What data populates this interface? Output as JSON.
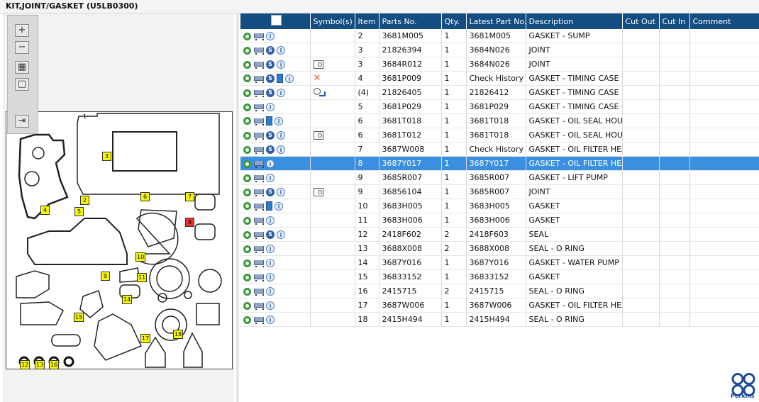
{
  "window_title": "KIT,JOINT/GASKET (U5LB0300)",
  "diagram": {
    "top_label": "1",
    "toolbar": [
      "zoom-in",
      "zoom-out",
      "fit",
      "actual-size",
      "export"
    ]
  },
  "columns": [
    "",
    "Symbol(s)",
    "Item",
    "Parts No.",
    "Qty.",
    "Latest Part No.",
    "Description",
    "Cut Out",
    "Cut In",
    "Comment"
  ],
  "rows": [
    {
      "icons": [
        "gear",
        "cart",
        "info"
      ],
      "symbol": "",
      "item": "2",
      "parts_no": "3681M005",
      "qty": "1",
      "latest": "3681M005",
      "desc": "GASKET - SUMP",
      "cut_out": "",
      "cut_in": "",
      "comment": ""
    },
    {
      "icons": [
        "gear",
        "cart",
        "s",
        "info"
      ],
      "symbol": "",
      "item": "3",
      "parts_no": "21826394",
      "qty": "1",
      "latest": "3684N026",
      "desc": "JOINT",
      "cut_out": "",
      "cut_in": "",
      "comment": ""
    },
    {
      "icons": [
        "gear",
        "cart",
        "s",
        "info"
      ],
      "symbol": "book-view",
      "item": "3",
      "parts_no": "3684R012",
      "qty": "1",
      "latest": "3684N026",
      "desc": "JOINT",
      "cut_out": "",
      "cut_in": "",
      "comment": ""
    },
    {
      "icons": [
        "gear",
        "cart",
        "s",
        "book",
        "info"
      ],
      "symbol": "x",
      "item": "4",
      "parts_no": "3681P009",
      "qty": "1",
      "latest": "Check History",
      "desc": "GASKET - TIMING CASE",
      "cut_out": "",
      "cut_in": "",
      "comment": ""
    },
    {
      "icons": [
        "gear",
        "cart",
        "s",
        "info"
      ],
      "symbol": "history",
      "item": "(4)",
      "parts_no": "21826405",
      "qty": "1",
      "latest": "21826412",
      "desc": "GASKET - TIMING CASE",
      "cut_out": "",
      "cut_in": "",
      "comment": ""
    },
    {
      "icons": [
        "gear",
        "cart",
        "info"
      ],
      "symbol": "",
      "item": "5",
      "parts_no": "3681P029",
      "qty": "1",
      "latest": "3681P029",
      "desc": "GASKET - TIMING CASE CO",
      "cut_out": "",
      "cut_in": "",
      "comment": ""
    },
    {
      "icons": [
        "gear",
        "cart",
        "book",
        "info"
      ],
      "symbol": "",
      "item": "6",
      "parts_no": "3681T018",
      "qty": "1",
      "latest": "3681T018",
      "desc": "GASKET - OIL SEAL HOUSIN",
      "cut_out": "",
      "cut_in": "",
      "comment": ""
    },
    {
      "icons": [
        "gear",
        "cart",
        "s",
        "info"
      ],
      "symbol": "book-view",
      "item": "6",
      "parts_no": "3681T012",
      "qty": "1",
      "latest": "3681T018",
      "desc": "GASKET - OIL SEAL HOUSIN",
      "cut_out": "",
      "cut_in": "",
      "comment": ""
    },
    {
      "icons": [
        "gear",
        "cart",
        "s",
        "info"
      ],
      "symbol": "",
      "item": "7",
      "parts_no": "3687W008",
      "qty": "1",
      "latest": "Check History",
      "desc": "GASKET - OIL FILTER HEAD",
      "cut_out": "",
      "cut_in": "",
      "comment": ""
    },
    {
      "icons": [
        "gear",
        "cart",
        "info"
      ],
      "symbol": "",
      "item": "8",
      "parts_no": "3687Y017",
      "qty": "1",
      "latest": "3687Y017",
      "desc": "GASKET - OIL FILTER HEAD",
      "cut_out": "",
      "cut_in": "",
      "comment": "",
      "selected": true
    },
    {
      "icons": [
        "gear",
        "cart",
        "info"
      ],
      "symbol": "",
      "item": "9",
      "parts_no": "3685R007",
      "qty": "1",
      "latest": "3685R007",
      "desc": "GASKET - LIFT PUMP",
      "cut_out": "",
      "cut_in": "",
      "comment": ""
    },
    {
      "icons": [
        "gear",
        "cart",
        "s",
        "info"
      ],
      "symbol": "book-view",
      "item": "9",
      "parts_no": "36856104",
      "qty": "1",
      "latest": "3685R007",
      "desc": "JOINT",
      "cut_out": "",
      "cut_in": "",
      "comment": ""
    },
    {
      "icons": [
        "gear",
        "cart",
        "book",
        "info"
      ],
      "symbol": "",
      "item": "10",
      "parts_no": "3683H005",
      "qty": "1",
      "latest": "3683H005",
      "desc": "GASKET",
      "cut_out": "",
      "cut_in": "",
      "comment": ""
    },
    {
      "icons": [
        "gear",
        "cart",
        "info"
      ],
      "symbol": "",
      "item": "11",
      "parts_no": "3683H006",
      "qty": "1",
      "latest": "3683H006",
      "desc": "GASKET",
      "cut_out": "",
      "cut_in": "",
      "comment": ""
    },
    {
      "icons": [
        "gear",
        "cart",
        "s",
        "info"
      ],
      "symbol": "",
      "item": "12",
      "parts_no": "2418F602",
      "qty": "2",
      "latest": "2418F603",
      "desc": "SEAL",
      "cut_out": "",
      "cut_in": "",
      "comment": ""
    },
    {
      "icons": [
        "gear",
        "cart",
        "info"
      ],
      "symbol": "",
      "item": "13",
      "parts_no": "3688X008",
      "qty": "2",
      "latest": "3688X008",
      "desc": "SEAL - O RING",
      "cut_out": "",
      "cut_in": "",
      "comment": ""
    },
    {
      "icons": [
        "gear",
        "cart",
        "info"
      ],
      "symbol": "",
      "item": "14",
      "parts_no": "3687Y016",
      "qty": "1",
      "latest": "3687Y016",
      "desc": "GASKET - WATER PUMP",
      "cut_out": "",
      "cut_in": "",
      "comment": ""
    },
    {
      "icons": [
        "gear",
        "cart",
        "info"
      ],
      "symbol": "",
      "item": "15",
      "parts_no": "36833152",
      "qty": "1",
      "latest": "36833152",
      "desc": "GASKET",
      "cut_out": "",
      "cut_in": "",
      "comment": ""
    },
    {
      "icons": [
        "gear",
        "cart",
        "info"
      ],
      "symbol": "",
      "item": "16",
      "parts_no": "2415715",
      "qty": "2",
      "latest": "2415715",
      "desc": "SEAL - O RING",
      "cut_out": "",
      "cut_in": "",
      "comment": ""
    },
    {
      "icons": [
        "gear",
        "cart",
        "info"
      ],
      "symbol": "",
      "item": "17",
      "parts_no": "3687W006",
      "qty": "1",
      "latest": "3687W006",
      "desc": "GASKET - OIL FILTER HEAD",
      "cut_out": "",
      "cut_in": "",
      "comment": ""
    },
    {
      "icons": [
        "gear",
        "cart",
        "info"
      ],
      "symbol": "",
      "item": "18",
      "parts_no": "2415H494",
      "qty": "1",
      "latest": "2415H494",
      "desc": "SEAL - O RING",
      "cut_out": "",
      "cut_in": "",
      "comment": ""
    }
  ],
  "brand": {
    "name": "Perkins",
    "color": "#1b4c9b"
  },
  "colors": {
    "header_bg": "#134d82",
    "selected_row": "#3a8fe0",
    "callout": "#f7f700"
  }
}
